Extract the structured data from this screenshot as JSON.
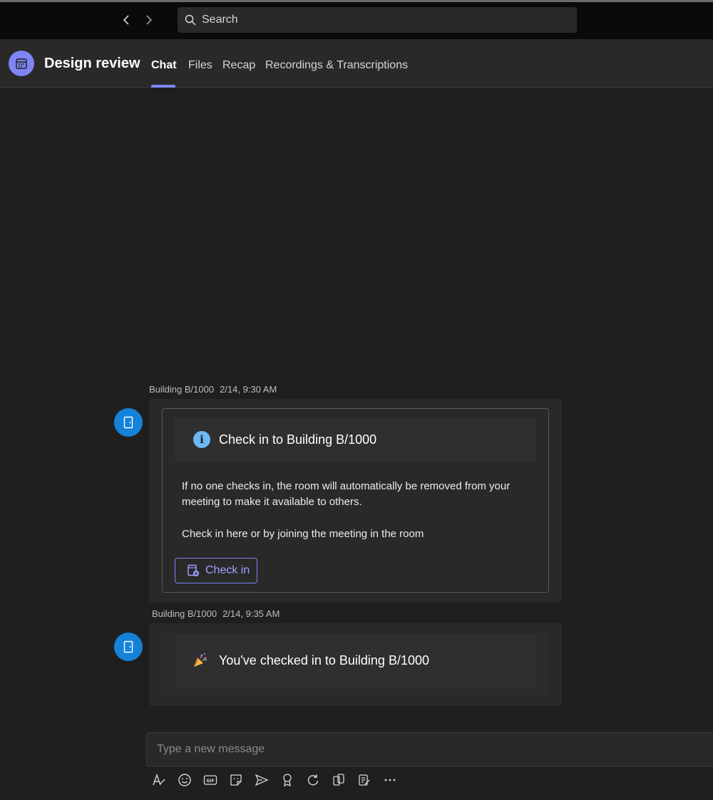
{
  "search": {
    "placeholder": "Search"
  },
  "header": {
    "title": "Design review",
    "tabs": [
      {
        "label": "Chat",
        "active": true
      },
      {
        "label": "Files"
      },
      {
        "label": "Recap"
      },
      {
        "label": "Recordings & Transcriptions"
      }
    ]
  },
  "messages": [
    {
      "sender": "Building B/1000",
      "time": "2/14, 9:30 AM",
      "card_title": "Check in to Building B/1000",
      "body1": "If no one checks in, the room will automatically be removed from your meeting to make it available to others.",
      "body2": "Check in here or by joining the meeting in the room",
      "button_label": "Check in"
    },
    {
      "sender": "Building B/1000",
      "time": "2/14, 9:35 AM",
      "text": "You've checked in to Building B/1000"
    }
  ],
  "compose": {
    "placeholder": "Type a new message"
  },
  "toolbar_icons": [
    "format-icon",
    "emoji-icon",
    "gif-icon",
    "sticker-icon",
    "send-schedule-icon",
    "praise-icon",
    "loop-icon",
    "apps-icon",
    "approvals-icon",
    "more-icon"
  ],
  "colors": {
    "accent": "#7f85f5",
    "avatar": "#1582d8",
    "info": "#6cb8f6"
  }
}
